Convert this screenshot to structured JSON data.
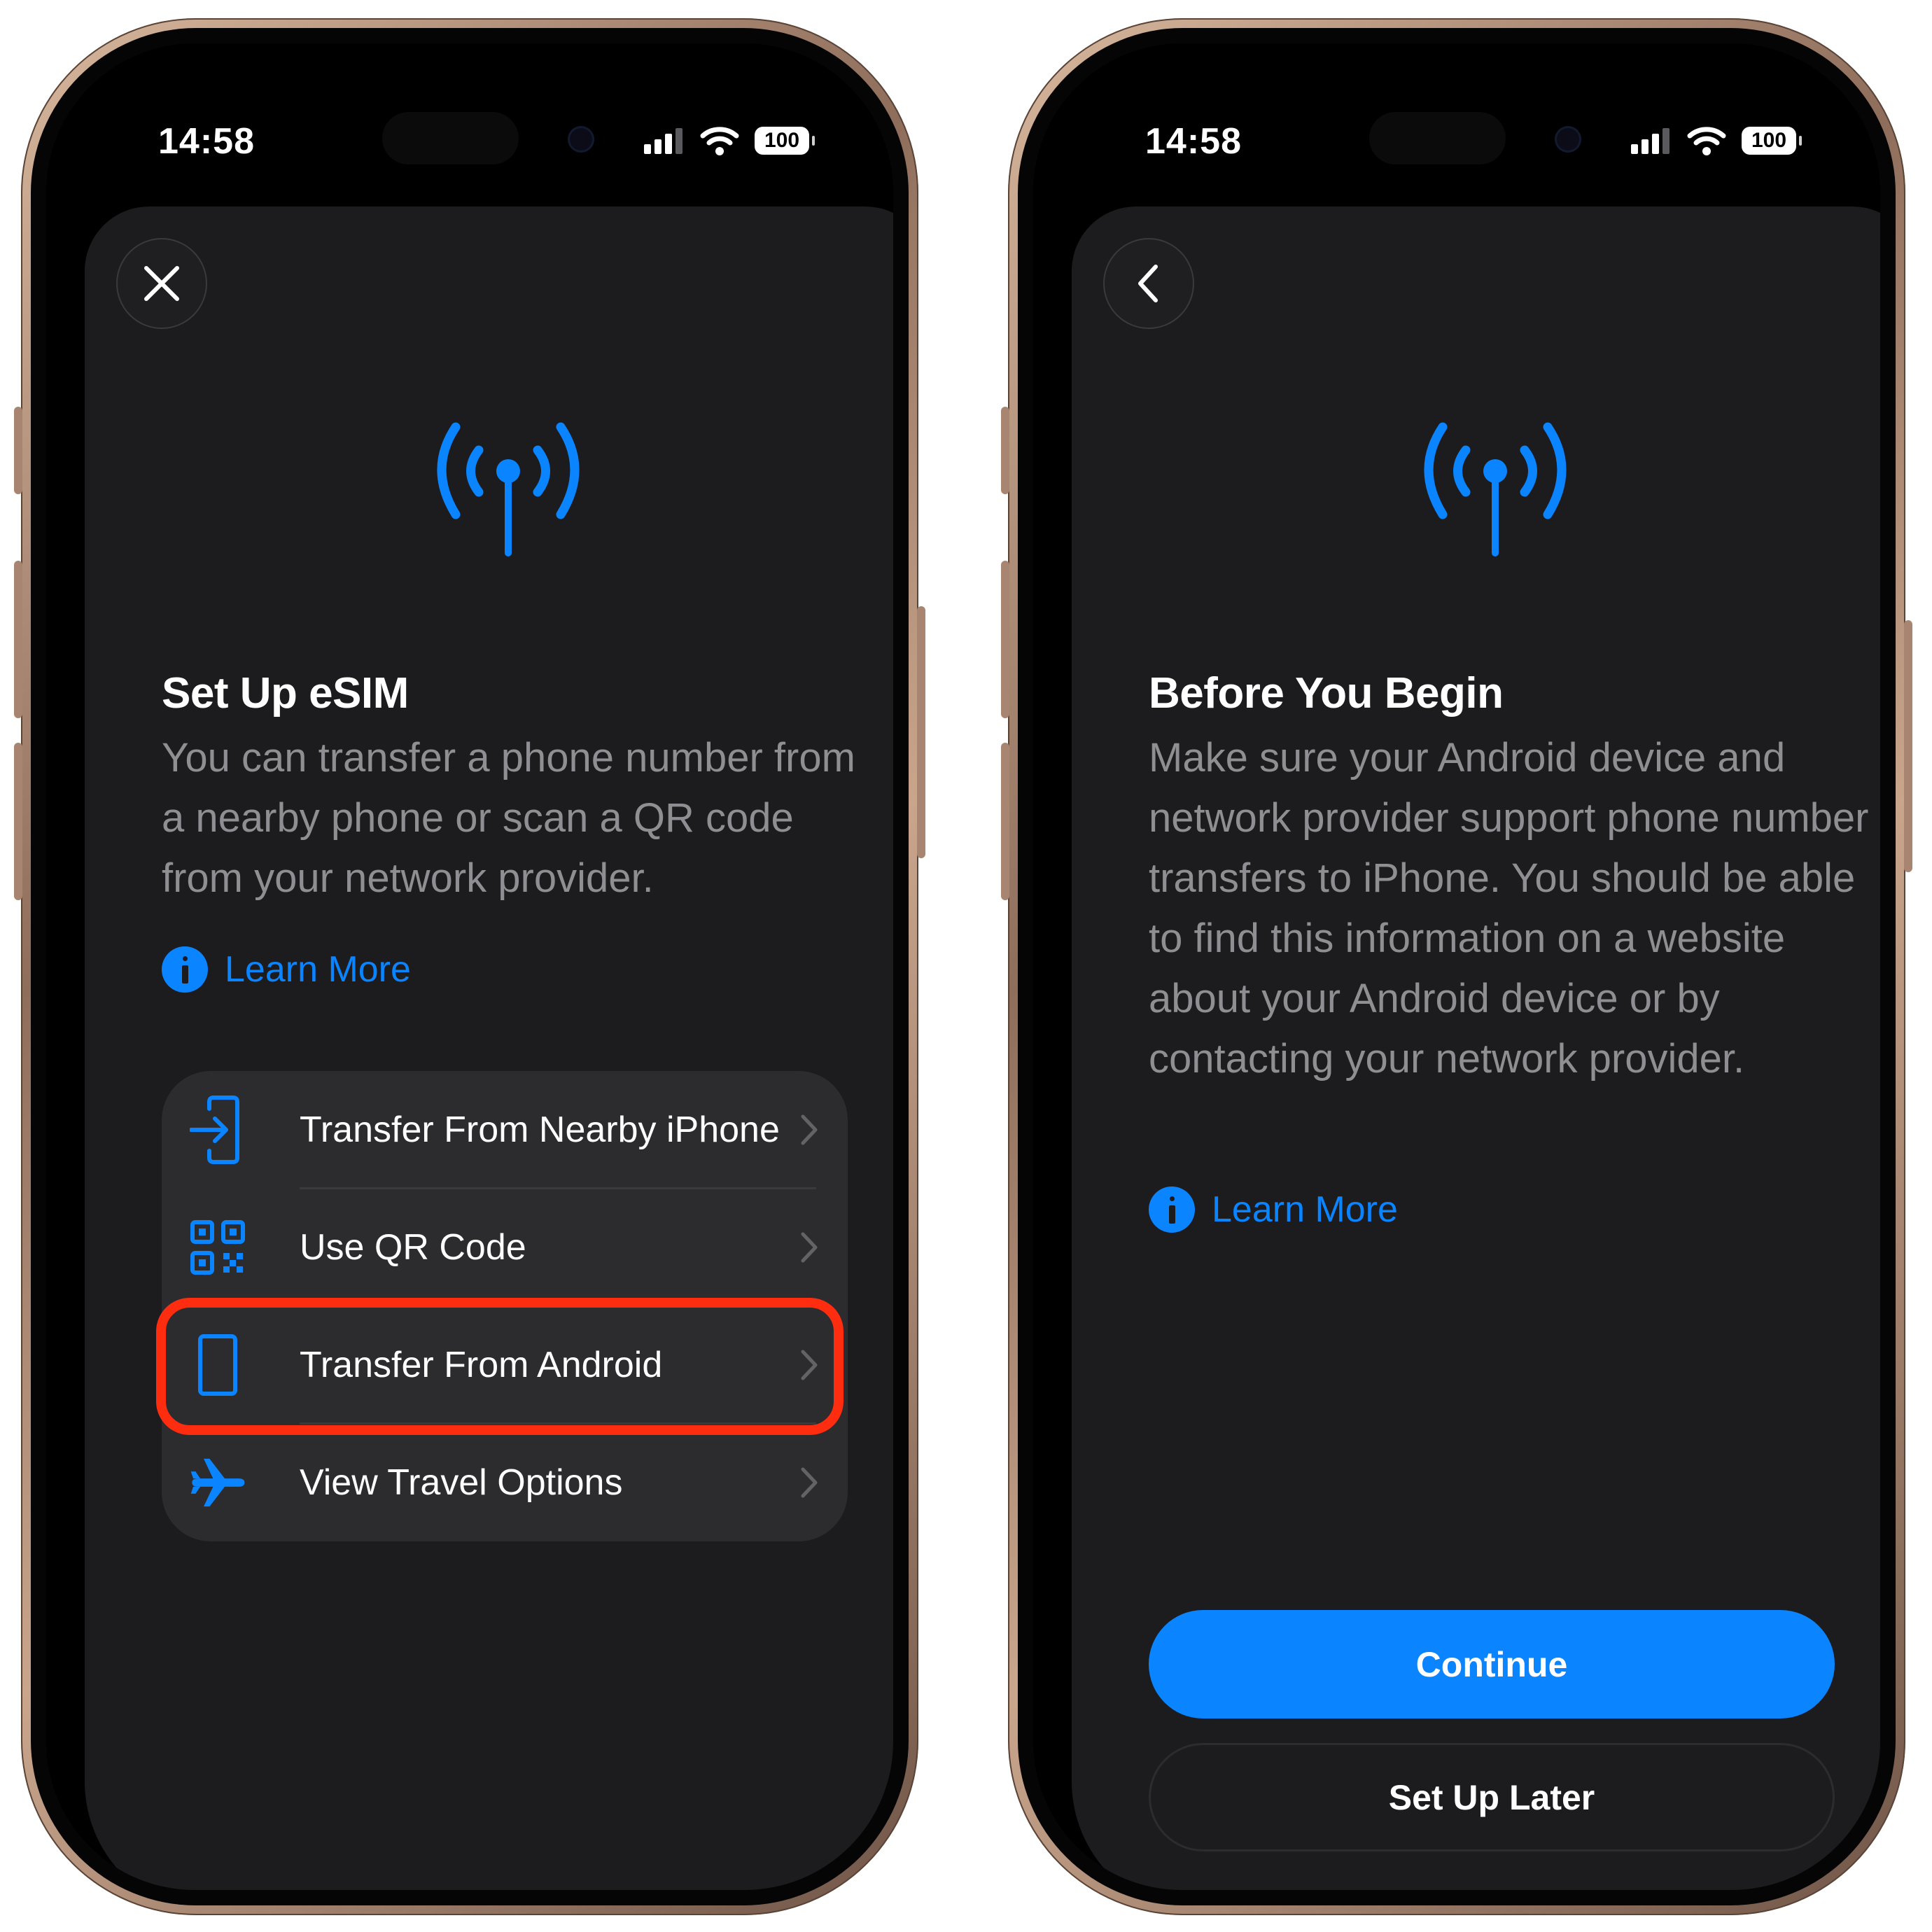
{
  "colors": {
    "accent": "#0a84ff",
    "highlight": "#ff2d10",
    "sheet_background": "#1c1c1e",
    "list_background": "#2c2c2e",
    "secondary_text": "#8e8e93"
  },
  "left_phone": {
    "status_bar": {
      "time": "14:58",
      "signal_icon": "cellular-signal-icon",
      "wifi_icon": "wifi-icon",
      "battery_level": "100"
    },
    "close_icon": "close-icon",
    "hero_icon": "antenna-radiowaves-icon",
    "title": "Set Up eSIM",
    "body": "You can transfer a phone number from a nearby phone or scan a QR code from your network provider.",
    "learn_more": {
      "icon": "info-icon",
      "label": "Learn More"
    },
    "options": [
      {
        "icon": "transfer-in-icon",
        "label": "Transfer From Nearby iPhone"
      },
      {
        "icon": "qr-code-icon",
        "label": "Use QR Code"
      },
      {
        "icon": "phone-outline-icon",
        "label": "Transfer From Android",
        "highlighted": true
      },
      {
        "icon": "airplane-icon",
        "label": "View Travel Options"
      }
    ]
  },
  "right_phone": {
    "status_bar": {
      "time": "14:58",
      "signal_icon": "cellular-signal-icon",
      "wifi_icon": "wifi-icon",
      "battery_level": "100"
    },
    "back_icon": "chevron-left-icon",
    "hero_icon": "antenna-radiowaves-icon",
    "title": "Before You Begin",
    "body": "Make sure your Android device and network provider support phone number transfers to iPhone. You should be able to find this information on a website about your Android device or by contacting your network provider.",
    "learn_more": {
      "icon": "info-icon",
      "label": "Learn More"
    },
    "continue_label": "Continue",
    "set_up_later_label": "Set Up Later"
  }
}
